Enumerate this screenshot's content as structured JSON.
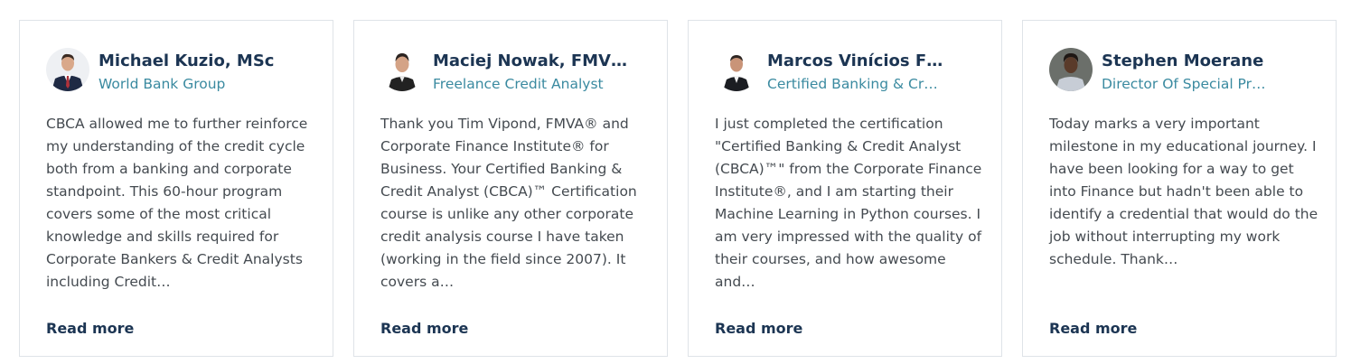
{
  "testimonials": [
    {
      "name": "Michael Kuzio, MSc",
      "role": "World Bank Group",
      "text_lines": [
        "CBCA allowed me to further reinforce",
        "my understanding of the credit cycle",
        "both from a banking and corporate",
        "standpoint. This 60-hour program",
        "covers some of the most critical",
        "knowledge and skills required for",
        "Corporate Bankers & Credit Analysts",
        "including Credit…"
      ],
      "read_more": "Read more"
    },
    {
      "name": "Maciej Nowak, FMV…",
      "role": "Freelance Credit Analyst",
      "text_lines": [
        "Thank you Tim Vipond, FMVA® and",
        "Corporate Finance Institute® for",
        "Business. Your Certified Banking &",
        "Credit Analyst (CBCA)™ Certification",
        "course is unlike any other corporate",
        "credit analysis course I have taken",
        "(working in the field since 2007). It",
        "covers a…"
      ],
      "read_more": "Read more"
    },
    {
      "name": "Marcos Vinícios F…",
      "role": "Certified Banking & Cr…",
      "text_lines": [
        "I just completed the certification",
        "\"Certified Banking & Credit Analyst",
        "(CBCA)™\" from the Corporate Finance",
        "Institute®, and I am starting their",
        "Machine Learning in Python courses. I",
        "am very impressed with the quality of",
        "their courses, and how awesome",
        "and…"
      ],
      "read_more": "Read more"
    },
    {
      "name": "Stephen Moerane",
      "role": "Director Of Special Pr…",
      "text_lines": [
        "Today marks a very important",
        "milestone in my educational journey. I",
        "have been looking for a way to get",
        "into Finance but hadn't been able to",
        "identify a credential that would do the",
        "job without interrupting my work",
        "schedule. Thank…"
      ],
      "read_more": "Read more"
    }
  ],
  "colors": {
    "name": "#1c3553",
    "role": "#3a8aa0",
    "body_text": "#444a50",
    "border": "#dfe3e8"
  }
}
